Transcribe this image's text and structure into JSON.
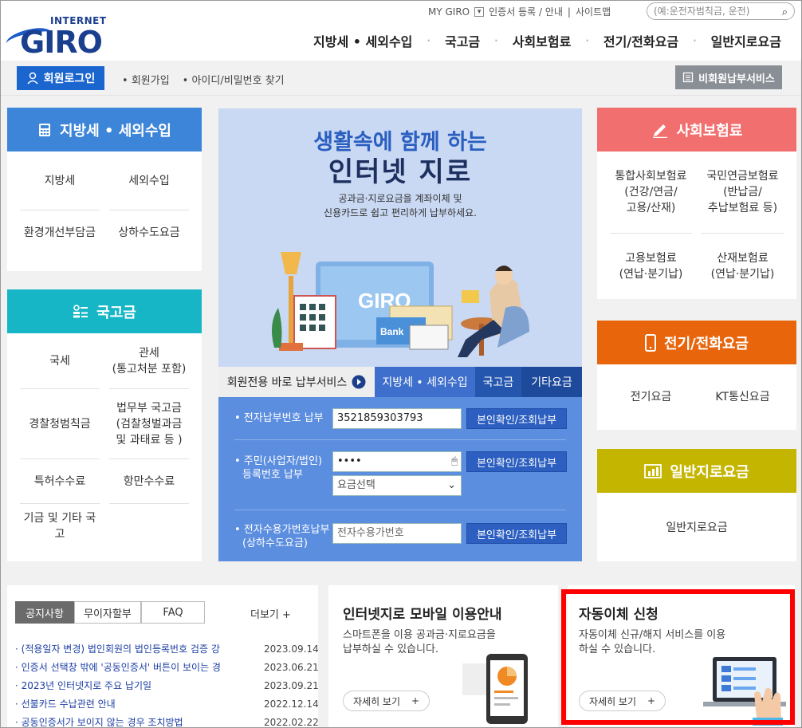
{
  "header": {
    "logo_small": "INTERNET",
    "logo_big": "GIRO",
    "util_links": [
      "MY GIRO",
      "인증서 등록 / 안내",
      "사이트맵"
    ],
    "search_placeholder": "(예:운전자범칙금, 운전)",
    "gnb": [
      "지방세 • 세외수입",
      "국고금",
      "사회보험료",
      "전기/전화요금",
      "일반지로요금"
    ]
  },
  "loginbar": {
    "login_label": "회원로그인",
    "links": [
      "회원가입",
      "아이디/비밀번호 찾기"
    ],
    "nonmember_label": "비회원납부서비스"
  },
  "categories": {
    "local": {
      "title": "지방세 • 세외수입",
      "color": "#3d85d8",
      "items": [
        "지방세",
        "세외수입",
        "환경개선부담금",
        "상하수도요금"
      ]
    },
    "national": {
      "title": "국고금",
      "color": "#17b6c7",
      "items": [
        "국세",
        "관세\n(통고처분 포함)",
        "경찰청범칙금",
        "법무부 국고금\n(검찰청벌과금\n및 과태료 등 )",
        "특허수수료",
        "항만수수료",
        "기금 및 기타 국고"
      ]
    },
    "social": {
      "title": "사회보험료",
      "color": "#f26f6f",
      "items": [
        "통합사회보험료\n(건강/연금/\n고용/산재)",
        "국민연금보험료\n(반납금/\n추납보험료 등)",
        "고용보험료\n(연납·분기납)",
        "산재보험료\n(연납·분기납)"
      ]
    },
    "phone": {
      "title": "전기/전화요금",
      "color": "#e8650c",
      "items": [
        "전기요금",
        "KT통신요금"
      ]
    },
    "general": {
      "title": "일반지로요금",
      "color": "#c4b500",
      "items": [
        "일반지로요금"
      ]
    }
  },
  "banner": {
    "line1": "생활속에 함께 하는",
    "line2": "인터넷 지로",
    "desc1": "공과금·지로요금을 계좌이체 및",
    "desc2": "신용카드로 쉽고 편리하게 납부하세요."
  },
  "tabs": {
    "member": "회원전용 바로 납부서비스",
    "local": "지방세 • 세외수입",
    "national": "국고금",
    "etc": "기타요금"
  },
  "form": {
    "row1_label": "• 전자납부번호 납부",
    "row1_value": "3521859303793",
    "row2_label_1": "• 주민(사업자/법인)",
    "row2_label_2": "등록번호 납부",
    "row2_value": "••••",
    "row2_select": "요금선택",
    "row3_label_1": "• 전자수용가번호납부",
    "row3_label_2": "(상하수도요금)",
    "row3_placeholder": "전자수용가번호",
    "button": "본인확인/조회납부"
  },
  "notice": {
    "tabs": [
      "공지사항",
      "무이자할부",
      "FAQ"
    ],
    "more": "더보기 +",
    "items": [
      {
        "title": "(적용일자 변경) 법인회원의 법인등록번호 검증 강",
        "date": "2023.09.14"
      },
      {
        "title": "인증서 선택창 밖에 '공동인증서' 버튼이 보이는 경",
        "date": "2023.06.21"
      },
      {
        "title": "2023년 인터넷지로 주요 납기일",
        "date": "2023.09.21"
      },
      {
        "title": "선불카드 수납관련 안내",
        "date": "2022.12.14"
      },
      {
        "title": "공동인증서가 보이지 않는 경우 조치방법",
        "date": "2022.02.22"
      }
    ]
  },
  "mobile_card": {
    "title": "인터넷지로 모바일 이용안내",
    "desc1": "스마트폰을 이용 공과금·지로요금을",
    "desc2": "납부하실 수 있습니다.",
    "button": "자세히 보기"
  },
  "auto_card": {
    "title": "자동이체 신청",
    "desc1": "자동이체 신규/해지 서비스를 이용",
    "desc2": "하실 수 있습니다.",
    "button": "자세히 보기"
  }
}
